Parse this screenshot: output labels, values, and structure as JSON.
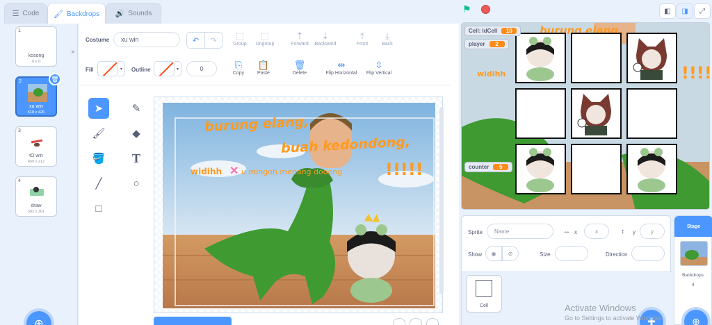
{
  "tabs": [
    {
      "label": "Code",
      "icon": "code-icon"
    },
    {
      "label": "Backdrops",
      "icon": "brush-icon",
      "active": true
    },
    {
      "label": "Sounds",
      "icon": "speaker-icon"
    }
  ],
  "costumes": [
    {
      "num": "1",
      "name": "kosong",
      "size": "0 x 0"
    },
    {
      "num": "2",
      "name": "xu win",
      "size": "518 x 426",
      "selected": true
    },
    {
      "num": "3",
      "name": "tO win",
      "size": "459 x 212"
    },
    {
      "num": "4",
      "name": "draw",
      "size": "583 x 301"
    }
  ],
  "editor": {
    "costume_label": "Costume",
    "costume_name": "xu win",
    "group": "Group",
    "ungroup": "Ungroup",
    "forward": "Forward",
    "backward": "Backward",
    "front": "Front",
    "back": "Back",
    "fill_label": "Fill",
    "outline_label": "Outline",
    "outline_width": "0",
    "copy": "Copy",
    "paste": "Paste",
    "delete": "Delete",
    "flip_h": "Flip Horizontal",
    "flip_v": "Flip Vertical"
  },
  "canvas_text": {
    "line1": "burung elang,",
    "line2": "buah kedondong,",
    "line3a": "widihh",
    "line3b": "u mingoh menang dooong",
    "line3c": "!!!!!"
  },
  "stage": {
    "monitors": [
      {
        "label": "Cell: IdCell",
        "value": "10"
      },
      {
        "label": "player",
        "value": "2"
      },
      {
        "label": "counter",
        "value": "5"
      }
    ],
    "bg_text1": "burung elang,",
    "bg_text2": "widihh",
    "bg_text3": "!!!!!"
  },
  "sprite_info": {
    "sprite_label": "Sprite",
    "name_placeholder": "Name",
    "x_label": "x",
    "x_placeholder": "x",
    "y_label": "y",
    "y_placeholder": "y",
    "show_label": "Show",
    "size_label": "Size",
    "direction_label": "Direction",
    "sprite_name": "Cell"
  },
  "stage_panel": {
    "title": "Stage",
    "backdrops_label": "Backdrops",
    "backdrops_count": "4"
  },
  "watermark": {
    "line1": "Activate Windows",
    "line2": "Go to Settings to activate Windows."
  },
  "colors": {
    "accent": "#4c97ff",
    "orange": "#ff8c1a",
    "text_orange": "#ff9a1f"
  }
}
